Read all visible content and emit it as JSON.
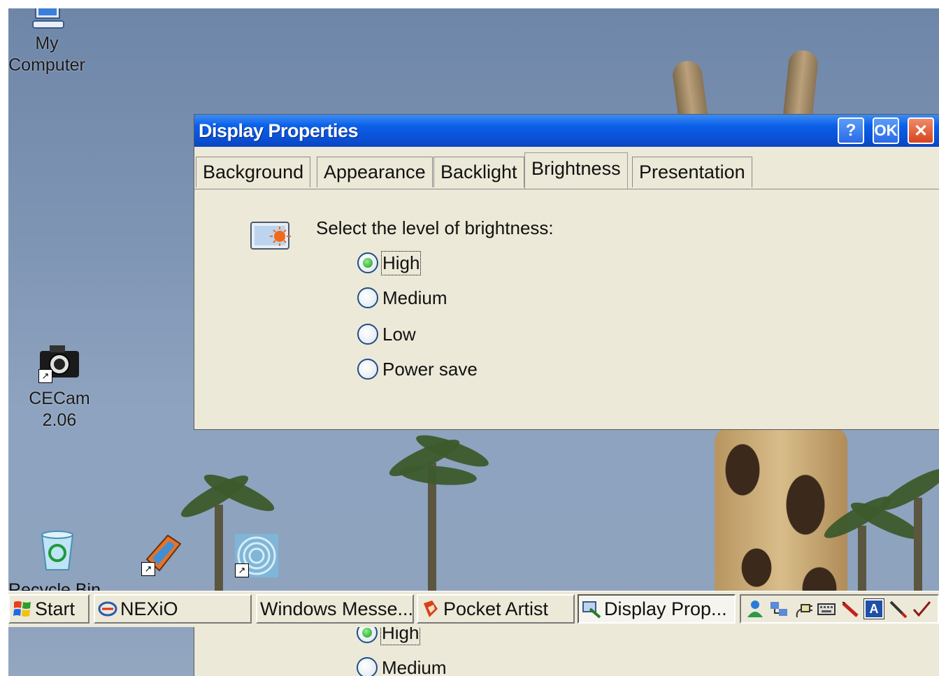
{
  "desktop": {
    "icons": [
      {
        "label_line1": "My",
        "label_line2": "Computer",
        "icon": "computer-icon"
      },
      {
        "label_line1": "CECam",
        "label_line2": "2.06",
        "icon": "camera-icon"
      },
      {
        "label": "Recycle Bin",
        "icon": "recycle-bin-icon"
      },
      {
        "label": "",
        "icon": "paint-app-icon"
      },
      {
        "label": "",
        "icon": "spiral-app-icon"
      }
    ]
  },
  "dialog": {
    "title": "Display Properties",
    "buttons": {
      "help": "?",
      "ok": "OK",
      "close": "✕"
    },
    "tabs": [
      "Background",
      "Appearance",
      "Backlight",
      "Brightness",
      "Presentation"
    ],
    "active_tab": "Brightness",
    "prompt": "Select the level of brightness:",
    "options": [
      "High",
      "Medium",
      "Low",
      "Power save"
    ],
    "selected_option": "High"
  },
  "taskbar": {
    "start": "Start",
    "items": [
      "NEXiO",
      "Windows Messe...",
      "Pocket Artist",
      "Display Prop..."
    ],
    "active_item": "Display Prop...",
    "tray_icons": [
      "user-icon",
      "network-icon",
      "power-plug-icon",
      "keyboard-icon",
      "pen-icon",
      "input-method-icon",
      "stylus-icon",
      "checkmark-icon"
    ],
    "tray_input_letter": "A"
  },
  "lower_partial": {
    "options": [
      "High",
      "Medium"
    ]
  },
  "colors": {
    "titlebar": "#0a52d8",
    "dialog_bg": "#ece9d8",
    "radio_selected": "#1a9a1a",
    "close_button": "#d8431d"
  }
}
